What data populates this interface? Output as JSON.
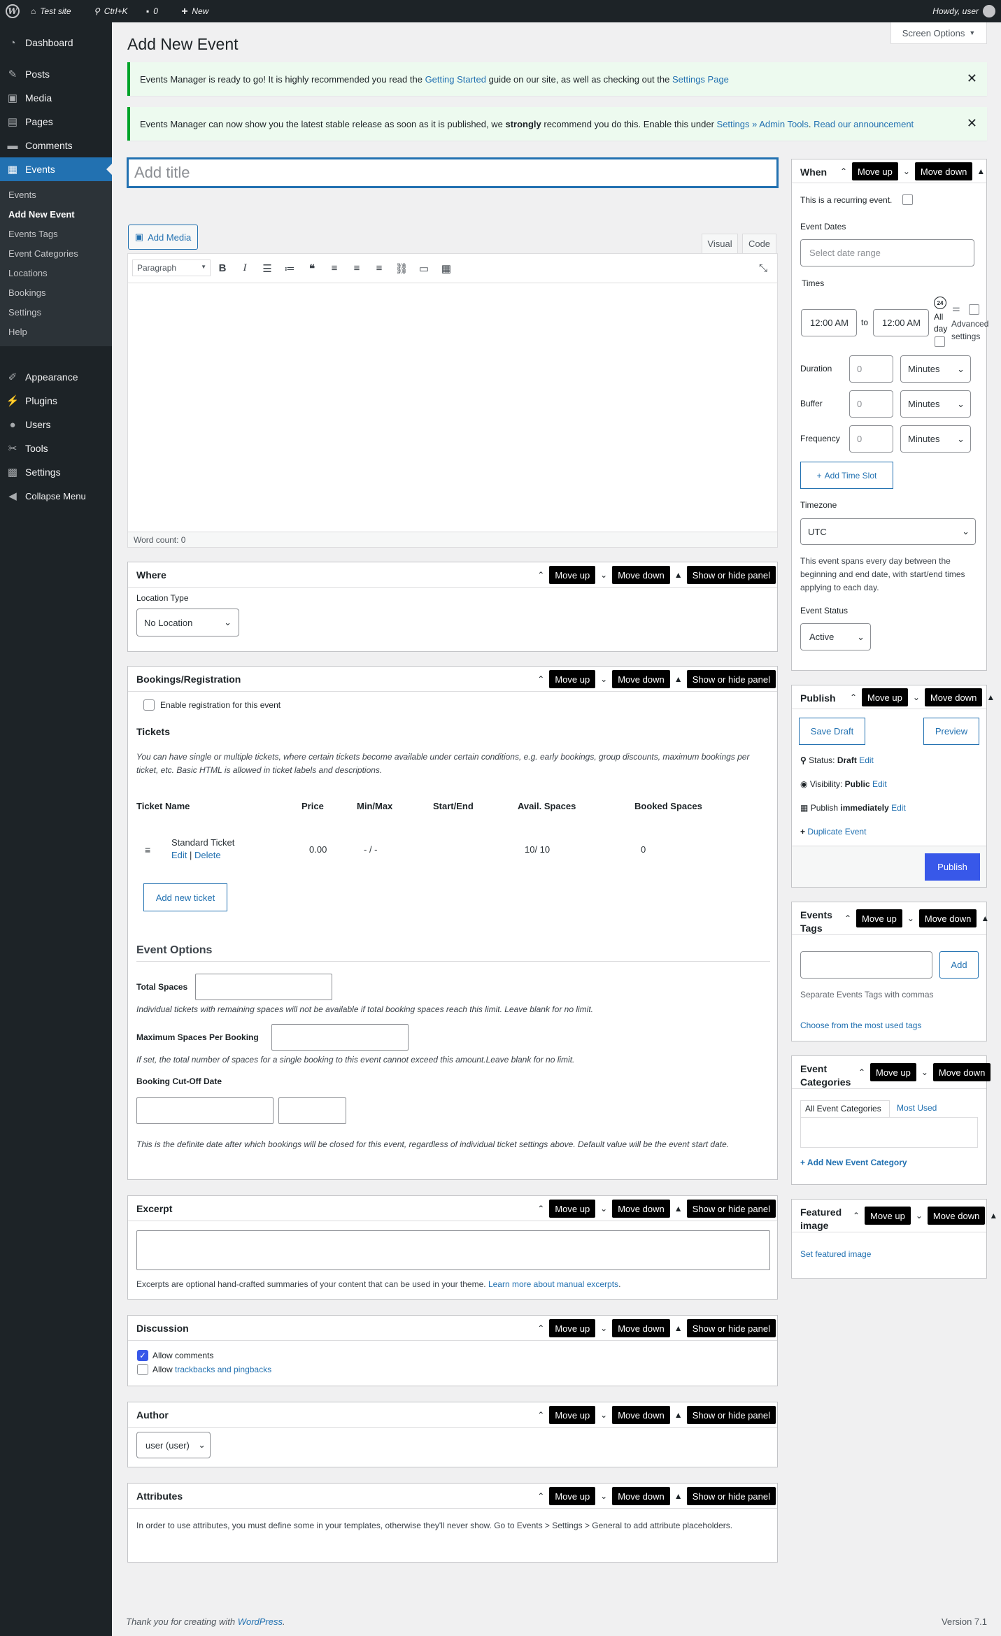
{
  "adminbar": {
    "site": "Test site",
    "search": "Ctrl+K",
    "comments": "0",
    "new": "New",
    "howdy": "Howdy, user"
  },
  "sidebar": {
    "items": [
      "Dashboard",
      "Posts",
      "Media",
      "Pages",
      "Comments",
      "Events",
      "Appearance",
      "Plugins",
      "Users",
      "Tools",
      "Settings",
      "Collapse Menu"
    ],
    "sub": [
      "Events",
      "Add New Event",
      "Events Tags",
      "Event Categories",
      "Locations",
      "Bookings",
      "Settings",
      "Help"
    ]
  },
  "page": {
    "title": "Add New Event",
    "screen_options": "Screen Options"
  },
  "notices": {
    "n1": {
      "pre": "Events Manager is ready to go! It is highly recommended you read the ",
      "link1": "Getting Started",
      "mid": " guide on our site, as well as checking out the ",
      "link2": "Settings Page"
    },
    "n2": {
      "pre": "Events Manager can now show you the latest stable release as soon as it is published, we ",
      "strong": "strongly",
      "mid": " recommend you do this. Enable this under ",
      "link1": "Settings » Admin Tools",
      "sep": ". ",
      "link2": "Read our announcement"
    }
  },
  "editor": {
    "title_placeholder": "Add title",
    "add_media": "Add Media",
    "tab_visual": "Visual",
    "tab_code": "Code",
    "format": "Paragraph",
    "word_count": "Word count: 0"
  },
  "panel": {
    "move_up": "Move up",
    "move_down": "Move down",
    "toggle": "Show or hide panel"
  },
  "where": {
    "title": "Where",
    "location_type_label": "Location Type",
    "location_type": "No Location"
  },
  "bookings": {
    "title": "Bookings/Registration",
    "enable": "Enable registration for this event",
    "tickets_heading": "Tickets",
    "tickets_desc": "You can have single or multiple tickets, where certain tickets become available under certain conditions, e.g. early bookings, group discounts, maximum bookings per ticket, etc. Basic HTML is allowed in ticket labels and descriptions.",
    "cols": [
      "Ticket Name",
      "Price",
      "Min/Max",
      "Start/End",
      "Avail. Spaces",
      "Booked Spaces"
    ],
    "ticket": {
      "name": "Standard Ticket",
      "edit": "Edit",
      "sep": "|",
      "delete": "Delete",
      "price": "0.00",
      "minmax": "- / -",
      "avail": "10/ 10",
      "booked": "0"
    },
    "add_ticket": "Add new ticket",
    "options_heading": "Event Options",
    "total_spaces": "Total Spaces",
    "total_desc": "Individual tickets with remaining spaces will not be available if total booking spaces reach this limit. Leave blank for no limit.",
    "max_spaces": "Maximum Spaces Per Booking",
    "max_desc": "If set, the total number of spaces for a single booking to this event cannot exceed this amount.Leave blank for no limit.",
    "cutoff": "Booking Cut-Off Date",
    "cutoff_desc": "This is the definite date after which bookings will be closed for this event, regardless of individual ticket settings above. Default value will be the event start date."
  },
  "excerpt": {
    "title": "Excerpt",
    "desc": "Excerpts are optional hand-crafted summaries of your content that can be used in your theme. ",
    "link": "Learn more about manual excerpts",
    "end": "."
  },
  "discussion": {
    "title": "Discussion",
    "allow_comments": "Allow comments",
    "allow_pre": "Allow ",
    "allow_link": "trackbacks and pingbacks"
  },
  "author": {
    "title": "Author",
    "value": "user (user)"
  },
  "attributes": {
    "title": "Attributes",
    "desc": "In order to use attributes, you must define some in your templates, otherwise they'll never show. Go to Events > Settings > General to add attribute placeholders."
  },
  "when": {
    "title": "When",
    "recurring": "This is a recurring event.",
    "dates_label": "Event Dates",
    "dates_ph": "Select date range",
    "times_label": "Times",
    "start": "12:00 AM",
    "to": "to",
    "end": "12:00 AM",
    "allday": "All day",
    "badge": "24",
    "advanced": "Advanced settings",
    "duration": "Duration",
    "buffer": "Buffer",
    "frequency": "Frequency",
    "num_ph": "0",
    "unit": "Minutes",
    "add_slot": "Add Time Slot",
    "tz_label": "Timezone",
    "tz": "UTC",
    "spans": "This event spans every day between the beginning and end date, with start/end times applying to each day.",
    "status_label": "Event Status",
    "status": "Active"
  },
  "publish": {
    "title": "Publish",
    "save_draft": "Save Draft",
    "preview": "Preview",
    "status_pre": "Status: ",
    "status": "Draft",
    "edit": "Edit",
    "vis_pre": "Visibility: ",
    "vis": "Public",
    "pub_pre": "Publish ",
    "pub": "immediately",
    "duplicate": "Duplicate Event",
    "publish_btn": "Publish"
  },
  "tags": {
    "title": "Events Tags",
    "add": "Add",
    "help": "Separate Events Tags with commas",
    "choose": "Choose from the most used tags"
  },
  "categories": {
    "title": "Event Categories",
    "tab_all": "All Event Categories",
    "tab_used": "Most Used",
    "add_new": "+ Add New Event Category"
  },
  "featured": {
    "title": "Featured image",
    "set": "Set featured image"
  },
  "footer": {
    "pre": "Thank you for creating with ",
    "link": "WordPress",
    "end": ".",
    "version": "Version 7.1"
  },
  "colors": {
    "accent": "#2271b1",
    "primary": "#3858e9",
    "sidebar": "#1d2327",
    "notice": "#00a32a"
  }
}
